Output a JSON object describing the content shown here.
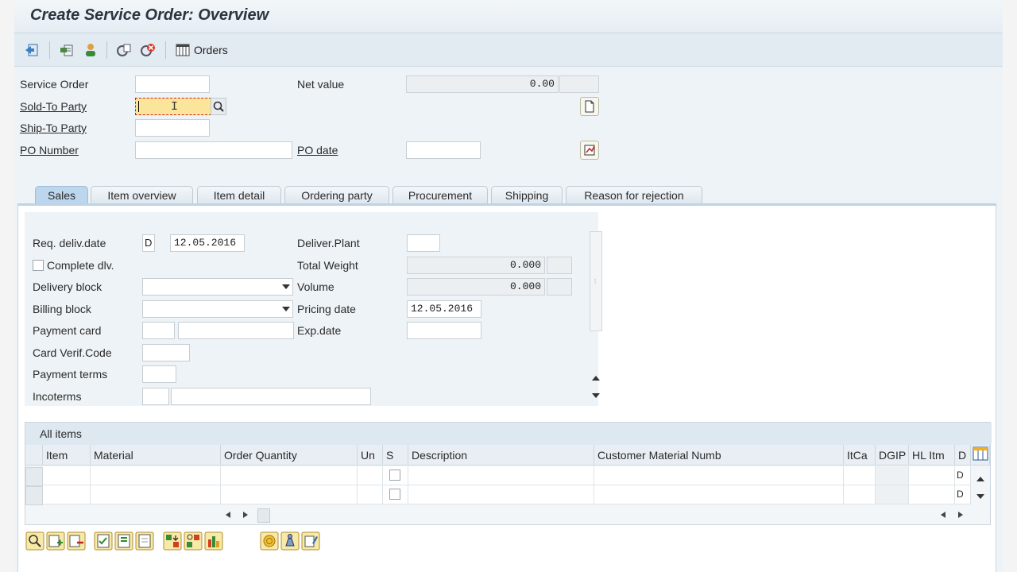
{
  "window": {
    "title": "Create Service Order: Overview"
  },
  "toolbar": {
    "orders_label": "Orders"
  },
  "header": {
    "service_order_label": "Service Order",
    "sold_to_label": "Sold-To Party",
    "ship_to_label": "Ship-To Party",
    "po_number_label": "PO Number",
    "net_value_label": "Net value",
    "net_value": "0.00",
    "po_date_label": "PO date"
  },
  "tabs": [
    {
      "label": "Sales"
    },
    {
      "label": "Item overview"
    },
    {
      "label": "Item detail"
    },
    {
      "label": "Ordering party"
    },
    {
      "label": "Procurement"
    },
    {
      "label": "Shipping"
    },
    {
      "label": "Reason for rejection"
    }
  ],
  "sales": {
    "req_deliv_date_label": "Req. deliv.date",
    "req_deliv_date_format": "D",
    "req_deliv_date": "12.05.2016",
    "complete_dlv_label": "Complete dlv.",
    "delivery_block_label": "Delivery block",
    "billing_block_label": "Billing block",
    "payment_card_label": "Payment card",
    "card_verif_label": "Card Verif.Code",
    "payment_terms_label": "Payment terms",
    "incoterms_label": "Incoterms",
    "deliver_plant_label": "Deliver.Plant",
    "total_weight_label": "Total Weight",
    "total_weight": "0.000",
    "volume_label": "Volume",
    "volume": "0.000",
    "pricing_date_label": "Pricing date",
    "pricing_date": "12.05.2016",
    "exp_date_label": "Exp.date"
  },
  "items": {
    "title": "All items",
    "columns": [
      "Item",
      "Material",
      "Order Quantity",
      "Un",
      "S",
      "Description",
      "Customer Material Numb",
      "ItCa",
      "DGIP",
      "HL Itm",
      "D"
    ],
    "rows": [
      {
        "d": "D"
      },
      {
        "d": "D"
      }
    ]
  }
}
